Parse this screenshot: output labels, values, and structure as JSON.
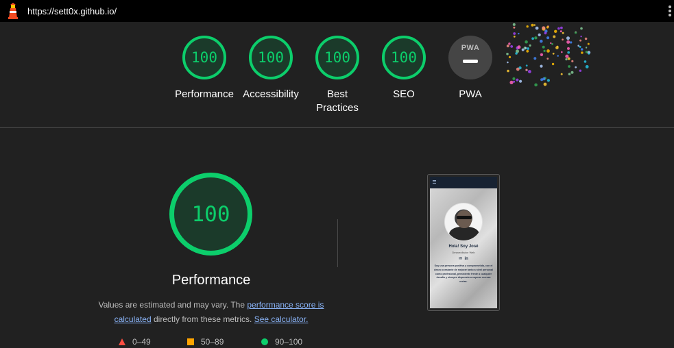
{
  "topbar": {
    "url": "https://sett0x.github.io/",
    "logo_icon": "lighthouse-icon",
    "menu_icon": "kebab-menu-icon"
  },
  "gauges": [
    {
      "id": "performance",
      "score": "100",
      "label": "Performance"
    },
    {
      "id": "accessibility",
      "score": "100",
      "label": "Accessibility"
    },
    {
      "id": "best-practices",
      "score": "100",
      "label": "Best Practices"
    },
    {
      "id": "seo",
      "score": "100",
      "label": "SEO"
    }
  ],
  "pwa": {
    "badge": "PWA",
    "label": "PWA"
  },
  "performance": {
    "score": "100",
    "title": "Performance",
    "desc_prefix": "Values are estimated and may vary. The ",
    "link_score": "performance score is calculated",
    "desc_middle": " directly from these metrics. ",
    "link_calc": "See calculator."
  },
  "legend": [
    {
      "range": "0–49",
      "shape": "triangle",
      "color": "#ff4e42"
    },
    {
      "range": "50–89",
      "shape": "square",
      "color": "#ffa400"
    },
    {
      "range": "90–100",
      "shape": "circle",
      "color": "#0cce6b"
    }
  ],
  "screenshot": {
    "name": "Hola! Soy José",
    "role": "Desarrollador Web",
    "bio": "Soy una persona positiva y comprometida, con el deseo constante de mejorar tanto a nivel personal como profesional, persistente frente a cualquier desafío y siempre dispuesto a superar nuevas metas."
  },
  "colors": {
    "pass": "#0cce6b",
    "average": "#ffa400",
    "fail": "#ff4e42",
    "link": "#8ab4f8"
  }
}
